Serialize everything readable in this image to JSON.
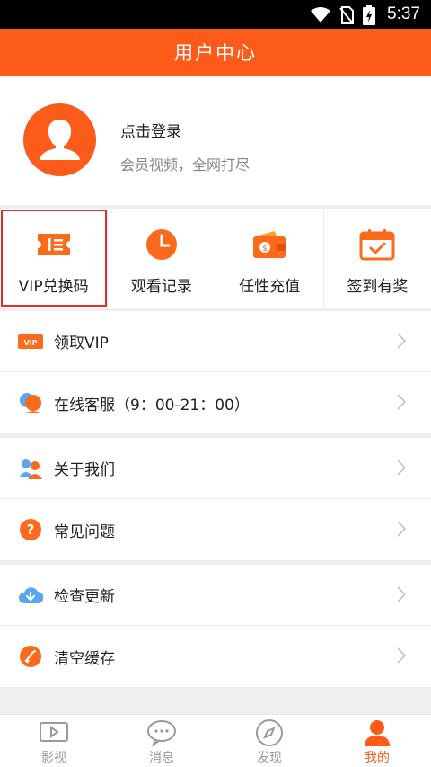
{
  "status_bar": {
    "time": "5:37"
  },
  "header": {
    "title": "用户中心"
  },
  "profile": {
    "login_label": "点击登录",
    "subtitle": "会员视频，全网打尽"
  },
  "quick_actions": [
    {
      "label": "VIP兑换码",
      "icon": "ticket-icon",
      "selected": true
    },
    {
      "label": "观看记录",
      "icon": "clock-icon"
    },
    {
      "label": "任性充值",
      "icon": "wallet-icon"
    },
    {
      "label": "签到有奖",
      "icon": "calendar-check-icon"
    }
  ],
  "menu_groups": [
    [
      {
        "label": "领取VIP",
        "icon": "vip-badge-icon"
      },
      {
        "label": "在线客服（9：00-21：00）",
        "icon": "customer-service-icon"
      }
    ],
    [
      {
        "label": "关于我们",
        "icon": "people-icon"
      },
      {
        "label": "常见问题",
        "icon": "question-icon"
      }
    ],
    [
      {
        "label": "检查更新",
        "icon": "cloud-download-icon"
      },
      {
        "label": "清空缓存",
        "icon": "broom-icon"
      }
    ]
  ],
  "tab_bar": [
    {
      "label": "影视",
      "icon": "video-icon"
    },
    {
      "label": "消息",
      "icon": "message-icon"
    },
    {
      "label": "发现",
      "icon": "compass-icon"
    },
    {
      "label": "我的",
      "icon": "user-icon",
      "active": true
    }
  ],
  "colors": {
    "brand": "#fc5b1a",
    "selection_border": "#d9302a"
  }
}
